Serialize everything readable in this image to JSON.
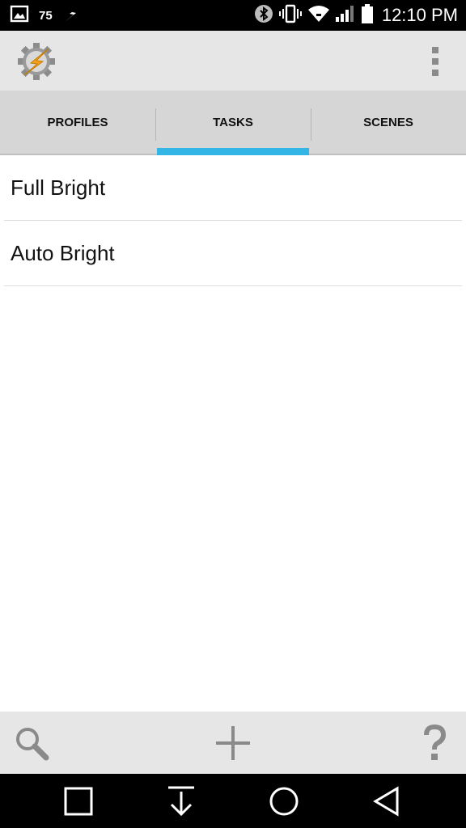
{
  "status_bar": {
    "notification_count": "75",
    "time": "12:10 PM",
    "icons": [
      "gallery-icon",
      "flash-icon",
      "bluetooth-icon",
      "vibrate-icon",
      "wifi-icon",
      "signal-icon",
      "battery-icon"
    ]
  },
  "app_bar": {
    "logo_icon": "tasker-gear-bolt-icon",
    "menu_icon": "overflow-menu-icon"
  },
  "tabs": [
    {
      "label": "PROFILES",
      "active": false
    },
    {
      "label": "TASKS",
      "active": true
    },
    {
      "label": "SCENES",
      "active": false
    }
  ],
  "accent_color": "#33b5e5",
  "tasks": [
    {
      "name": "Full Bright"
    },
    {
      "name": "Auto Bright"
    }
  ],
  "toolbar": {
    "icons": [
      "search-icon",
      "add-icon",
      "help-icon"
    ]
  },
  "nav_bar": {
    "icons": [
      "recents-icon",
      "notifications-pull-icon",
      "home-icon",
      "back-icon"
    ]
  }
}
